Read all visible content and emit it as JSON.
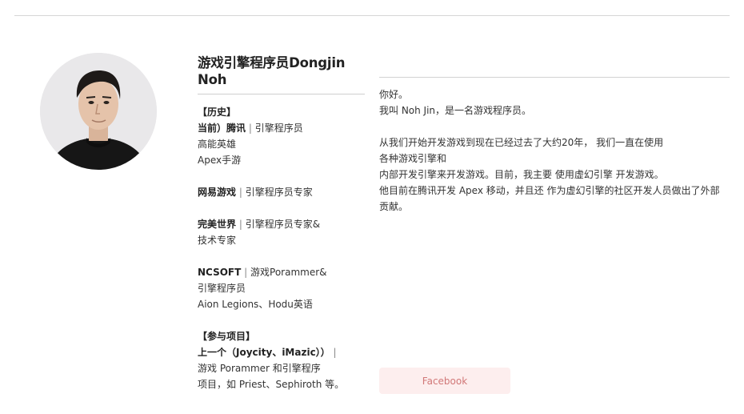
{
  "profile": {
    "name": "游戏引擎程序员Dongjin Noh",
    "history": {
      "heading": "【历史】",
      "tencent_current": "当前）腾讯",
      "tencent_role": "引擎程序员",
      "tencent_projects": [
        "高能英雄",
        "Apex手游"
      ],
      "netease": "网易游戏",
      "netease_role": "引擎程序员专家",
      "perfect_world": "完美世界",
      "perfect_world_role": "引擎程序员专家&",
      "perfect_world_role2": "技术专家",
      "ncsoft": "NCSOFT",
      "ncsoft_role": "游戏Porammer&",
      "ncsoft_role2": "引擎程序员",
      "ncsoft_projects": "Aion Legions、Hodu英语",
      "separator": "|"
    },
    "projects": {
      "heading": "【参与项目】",
      "previous": "上一个（Joycity、iMazic））",
      "line2": "游戏 Porammer 和引擎程序",
      "line3": "项目，如 Priest、Sephiroth 等。"
    }
  },
  "bio": {
    "greeting": "你好。",
    "intro": "我叫 Noh Jin，是一名游戏程序员。",
    "p1": "从我们开始开发游戏到现在已经过去了大约20年，  我们一直在使用",
    "p2": "各种游戏引擎和",
    "p3": "内部开发引擎来开发游戏。目前，我主要 使用虚幻引擎 开发游戏。",
    "p4": "他目前在腾讯开发 Apex 移动，并且还 作为虚幻引擎的社区开发人员做出了外部",
    "p5": "贡献。"
  },
  "social": {
    "facebook_label": "Facebook"
  },
  "colors": {
    "facebook_bg": "#fdeeee",
    "facebook_text": "#d17878"
  }
}
